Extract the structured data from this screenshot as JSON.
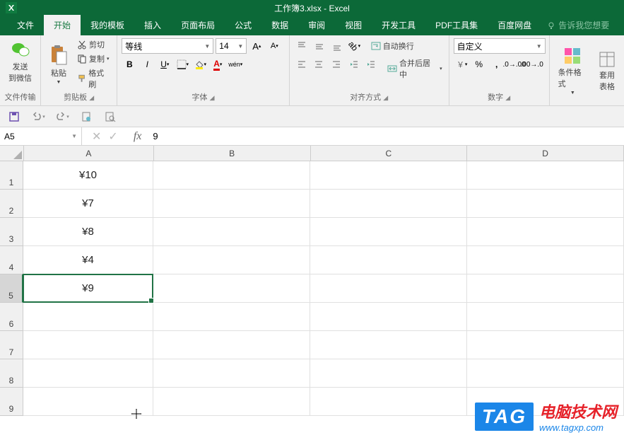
{
  "title": "工作簿3.xlsx - Excel",
  "tabs": [
    "文件",
    "开始",
    "我的模板",
    "插入",
    "页面布局",
    "公式",
    "数据",
    "审阅",
    "视图",
    "开发工具",
    "PDF工具集",
    "百度网盘"
  ],
  "active_tab": "开始",
  "tell_me": "告诉我您想要",
  "groups": {
    "file_transfer": {
      "label": "文件传输",
      "send_wechat": "发送\n到微信"
    },
    "clipboard": {
      "label": "剪贴板",
      "paste": "粘贴",
      "cut": "剪切",
      "copy": "复制",
      "format_painter": "格式刷"
    },
    "font": {
      "label": "字体",
      "name": "等线",
      "size": "14"
    },
    "alignment": {
      "label": "对齐方式",
      "wrap": "自动换行",
      "merge": "合并后居中"
    },
    "number": {
      "label": "数字",
      "format": "自定义"
    },
    "styles": {
      "cond_format": "条件格式",
      "table_styles": "套用\n表格"
    }
  },
  "name_box": "A5",
  "formula_value": "9",
  "columns": [
    "A",
    "B",
    "C",
    "D"
  ],
  "rows": [
    {
      "num": "1",
      "a": "¥10"
    },
    {
      "num": "2",
      "a": "¥7"
    },
    {
      "num": "3",
      "a": "¥8"
    },
    {
      "num": "4",
      "a": "¥4"
    },
    {
      "num": "5",
      "a": "¥9"
    },
    {
      "num": "6",
      "a": ""
    },
    {
      "num": "7",
      "a": ""
    },
    {
      "num": "8",
      "a": ""
    },
    {
      "num": "9",
      "a": ""
    }
  ],
  "selected_row_index": 4,
  "watermark": {
    "tag": "TAG",
    "line1": "电脑技术网",
    "line2": "www.tagxp.com"
  }
}
